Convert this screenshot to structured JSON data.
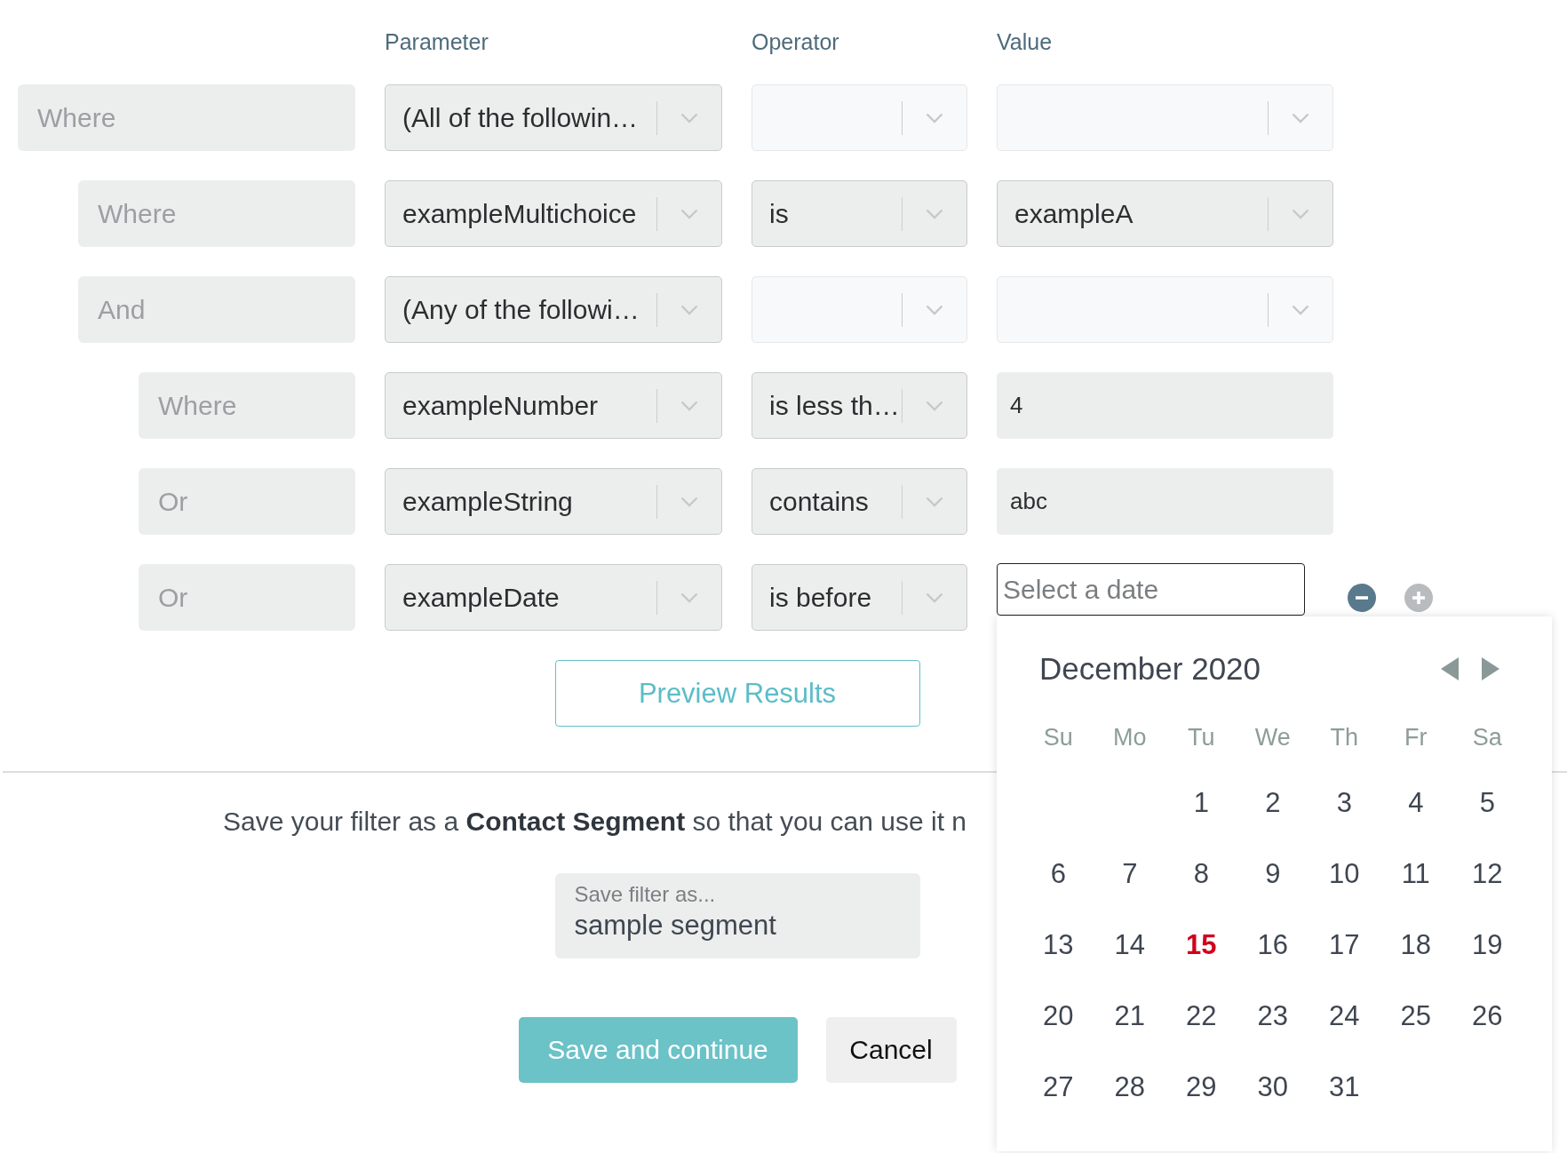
{
  "columns": [
    "Parameter",
    "Operator",
    "Value"
  ],
  "conditions": [
    {
      "conjunction": "Where",
      "parameter": {
        "value": "(All of the followin…"
      },
      "operator": {
        "disabled": true
      },
      "value": {
        "kind": "select",
        "disabled": true
      },
      "children": [
        {
          "conjunction": "Where",
          "parameter": {
            "value": "exampleMultichoice"
          },
          "operator": {
            "value": "is",
            "disabled": false
          },
          "value": {
            "kind": "select",
            "value": "exampleA",
            "disabled": false
          }
        },
        {
          "conjunction": "And",
          "parameter": {
            "value": "(Any of the followi…"
          },
          "operator": {
            "disabled": true
          },
          "value": {
            "kind": "select",
            "disabled": true
          },
          "children": [
            {
              "conjunction": "Where",
              "parameter": {
                "value": "exampleNumber"
              },
              "operator": {
                "value": "is less th…",
                "disabled": false
              },
              "value": {
                "kind": "text",
                "value": "4"
              }
            },
            {
              "conjunction": "Or",
              "parameter": {
                "value": "exampleString"
              },
              "operator": {
                "value": "contains",
                "disabled": false
              },
              "value": {
                "kind": "text",
                "value": "abc"
              }
            },
            {
              "conjunction": "Or",
              "parameter": {
                "value": "exampleDate"
              },
              "operator": {
                "value": "is before",
                "disabled": false
              },
              "value": {
                "kind": "date",
                "placeholder": "Select a date",
                "focused": true
              },
              "actions": [
                {
                  "kind": "remove",
                  "disabled": false
                },
                {
                  "kind": "add",
                  "disabled": true
                }
              ]
            }
          ]
        }
      ]
    }
  ],
  "preview_button": "Preview Results",
  "save_note": "Save your filter as a **Contact Segment** so that you can use it n",
  "save_field": {
    "label": "Save filter as...",
    "value": "sample segment"
  },
  "buttons": [
    {
      "label": "Save and continue",
      "kind": "primary"
    },
    {
      "label": "Cancel",
      "kind": "secondary"
    }
  ],
  "date_picker": {
    "title": "December 2020",
    "weekdays": [
      "Su",
      "Mo",
      "Tu",
      "We",
      "Th",
      "Fr",
      "Sa"
    ],
    "weeks": [
      {
        "days": [
          {
            "label": "1",
            "today": false
          },
          {
            "label": "2",
            "today": false
          },
          {
            "label": "3",
            "today": false
          },
          {
            "label": "4",
            "today": false
          },
          {
            "label": "5",
            "today": false
          }
        ]
      },
      {
        "days": [
          {
            "label": "6",
            "today": false
          },
          {
            "label": "7",
            "today": false
          },
          {
            "label": "8",
            "today": false
          },
          {
            "label": "9",
            "today": false
          },
          {
            "label": "10",
            "today": false
          },
          {
            "label": "11",
            "today": false
          },
          {
            "label": "12",
            "today": false
          }
        ]
      },
      {
        "days": [
          {
            "label": "13",
            "today": false
          },
          {
            "label": "14",
            "today": false
          },
          {
            "label": "15",
            "today": true
          },
          {
            "label": "16",
            "today": false
          },
          {
            "label": "17",
            "today": false
          },
          {
            "label": "18",
            "today": false
          },
          {
            "label": "19",
            "today": false
          }
        ]
      },
      {
        "days": [
          {
            "label": "20",
            "today": false
          },
          {
            "label": "21",
            "today": false
          },
          {
            "label": "22",
            "today": false
          },
          {
            "label": "23",
            "today": false
          },
          {
            "label": "24",
            "today": false
          },
          {
            "label": "25",
            "today": false
          },
          {
            "label": "26",
            "today": false
          }
        ]
      },
      {
        "days": [
          {
            "label": "27",
            "today": false
          },
          {
            "label": "28",
            "today": false
          },
          {
            "label": "29",
            "today": false
          },
          {
            "label": "30",
            "today": false
          },
          {
            "label": "31",
            "today": false
          }
        ]
      }
    ]
  }
}
